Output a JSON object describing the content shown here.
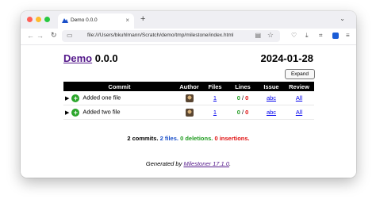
{
  "browser": {
    "tab_title": "Demo 0.0.0",
    "tab_close": "×",
    "new_tab": "+",
    "url": "file:///Users/bkuhlmann/Scratch/demo/tmp/milestone/index.html"
  },
  "page": {
    "project_link": "Demo",
    "version": "0.0.0",
    "date": "2024-01-28",
    "expand_label": "Expand"
  },
  "table": {
    "headers": {
      "commit": "Commit",
      "author": "Author",
      "files": "Files",
      "lines": "Lines",
      "issue": "Issue",
      "review": "Review"
    },
    "rows": [
      {
        "message": "Added one file",
        "files": "1",
        "additions": "0",
        "sep": "/",
        "deletions": "0",
        "issue": "abc",
        "review": "All"
      },
      {
        "message": "Added two file",
        "files": "1",
        "additions": "0",
        "sep": "/",
        "deletions": "0",
        "issue": "abc",
        "review": "All"
      }
    ]
  },
  "summary": {
    "commits": "2 commits.",
    "files": "2 files.",
    "deletions": "0 deletions.",
    "insertions": "0 insertions."
  },
  "footer": {
    "prefix": "Generated by",
    "link": "Milestoner 17.1.0",
    "suffix": "."
  },
  "colors": {
    "additions": "#1f9b1f",
    "deletions": "#e01010",
    "files": "#1a4fc9"
  }
}
